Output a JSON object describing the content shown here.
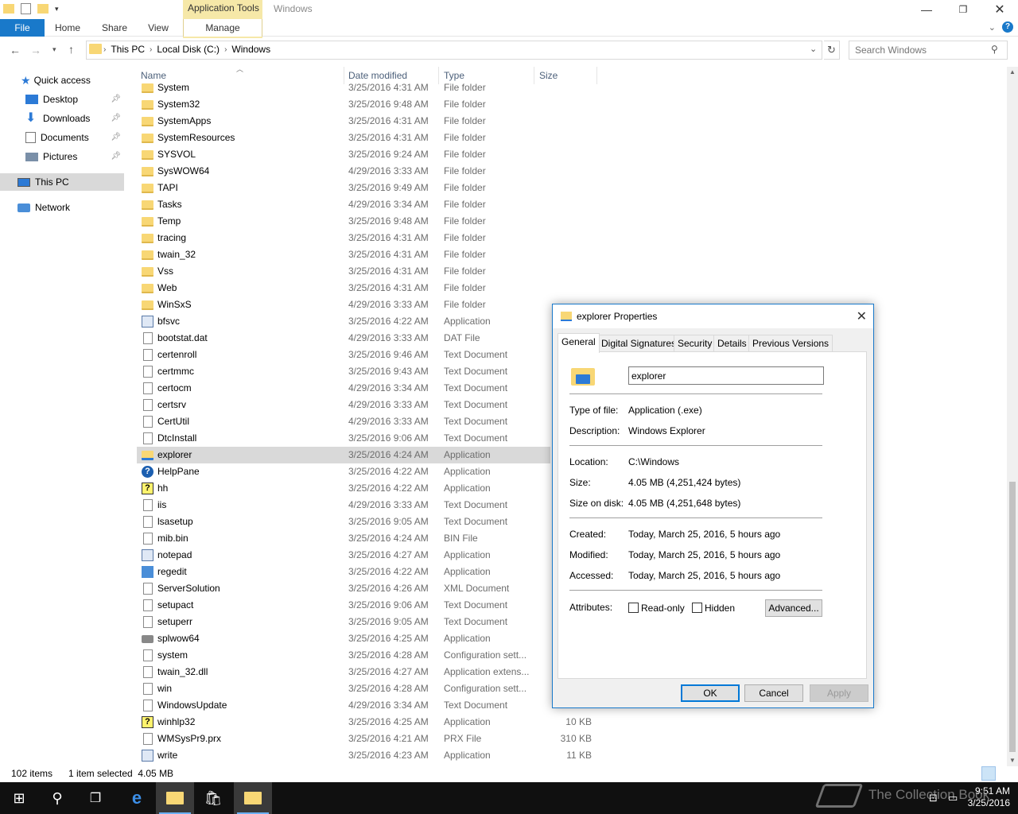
{
  "window": {
    "title": "Windows",
    "app_tools": "Application Tools"
  },
  "ribbon": {
    "tabs": [
      "File",
      "Home",
      "Share",
      "View",
      "Manage"
    ]
  },
  "address": {
    "crumbs": [
      "This PC",
      "Local Disk (C:)",
      "Windows"
    ],
    "search_placeholder": "Search Windows"
  },
  "nav": {
    "quick_access": "Quick access",
    "items": [
      "Desktop",
      "Downloads",
      "Documents",
      "Pictures"
    ],
    "this_pc": "This PC",
    "network": "Network"
  },
  "columns": {
    "name": "Name",
    "date": "Date modified",
    "type": "Type",
    "size": "Size"
  },
  "files": [
    {
      "name": "System",
      "date": "3/25/2016 4:31 AM",
      "type": "File folder",
      "size": "",
      "icon": "folder"
    },
    {
      "name": "System32",
      "date": "3/25/2016 9:48 AM",
      "type": "File folder",
      "size": "",
      "icon": "folder"
    },
    {
      "name": "SystemApps",
      "date": "3/25/2016 4:31 AM",
      "type": "File folder",
      "size": "",
      "icon": "folder"
    },
    {
      "name": "SystemResources",
      "date": "3/25/2016 4:31 AM",
      "type": "File folder",
      "size": "",
      "icon": "folder"
    },
    {
      "name": "SYSVOL",
      "date": "3/25/2016 9:24 AM",
      "type": "File folder",
      "size": "",
      "icon": "folder"
    },
    {
      "name": "SysWOW64",
      "date": "4/29/2016 3:33 AM",
      "type": "File folder",
      "size": "",
      "icon": "folder"
    },
    {
      "name": "TAPI",
      "date": "3/25/2016 9:49 AM",
      "type": "File folder",
      "size": "",
      "icon": "folder"
    },
    {
      "name": "Tasks",
      "date": "4/29/2016 3:34 AM",
      "type": "File folder",
      "size": "",
      "icon": "folder"
    },
    {
      "name": "Temp",
      "date": "3/25/2016 9:48 AM",
      "type": "File folder",
      "size": "",
      "icon": "folder"
    },
    {
      "name": "tracing",
      "date": "3/25/2016 4:31 AM",
      "type": "File folder",
      "size": "",
      "icon": "folder"
    },
    {
      "name": "twain_32",
      "date": "3/25/2016 4:31 AM",
      "type": "File folder",
      "size": "",
      "icon": "folder"
    },
    {
      "name": "Vss",
      "date": "3/25/2016 4:31 AM",
      "type": "File folder",
      "size": "",
      "icon": "folder"
    },
    {
      "name": "Web",
      "date": "3/25/2016 4:31 AM",
      "type": "File folder",
      "size": "",
      "icon": "folder"
    },
    {
      "name": "WinSxS",
      "date": "4/29/2016 3:33 AM",
      "type": "File folder",
      "size": "",
      "icon": "folder"
    },
    {
      "name": "bfsvc",
      "date": "3/25/2016 4:22 AM",
      "type": "Application",
      "size": "",
      "icon": "app"
    },
    {
      "name": "bootstat.dat",
      "date": "4/29/2016 3:33 AM",
      "type": "DAT File",
      "size": "",
      "icon": "doc"
    },
    {
      "name": "certenroll",
      "date": "3/25/2016 9:46 AM",
      "type": "Text Document",
      "size": "",
      "icon": "doc"
    },
    {
      "name": "certmmc",
      "date": "3/25/2016 9:43 AM",
      "type": "Text Document",
      "size": "",
      "icon": "doc"
    },
    {
      "name": "certocm",
      "date": "4/29/2016 3:34 AM",
      "type": "Text Document",
      "size": "",
      "icon": "doc"
    },
    {
      "name": "certsrv",
      "date": "4/29/2016 3:33 AM",
      "type": "Text Document",
      "size": "",
      "icon": "doc"
    },
    {
      "name": "CertUtil",
      "date": "4/29/2016 3:33 AM",
      "type": "Text Document",
      "size": "",
      "icon": "doc"
    },
    {
      "name": "DtcInstall",
      "date": "3/25/2016 9:06 AM",
      "type": "Text Document",
      "size": "",
      "icon": "doc"
    },
    {
      "name": "explorer",
      "date": "3/25/2016 4:24 AM",
      "type": "Application",
      "size": "",
      "icon": "explorer",
      "selected": true
    },
    {
      "name": "HelpPane",
      "date": "3/25/2016 4:22 AM",
      "type": "Application",
      "size": "",
      "icon": "help"
    },
    {
      "name": "hh",
      "date": "3/25/2016 4:22 AM",
      "type": "Application",
      "size": "",
      "icon": "hh"
    },
    {
      "name": "iis",
      "date": "4/29/2016 3:33 AM",
      "type": "Text Document",
      "size": "",
      "icon": "doc"
    },
    {
      "name": "lsasetup",
      "date": "3/25/2016 9:05 AM",
      "type": "Text Document",
      "size": "",
      "icon": "doc"
    },
    {
      "name": "mib.bin",
      "date": "3/25/2016 4:24 AM",
      "type": "BIN File",
      "size": "",
      "icon": "doc"
    },
    {
      "name": "notepad",
      "date": "3/25/2016 4:27 AM",
      "type": "Application",
      "size": "",
      "icon": "app"
    },
    {
      "name": "regedit",
      "date": "3/25/2016 4:22 AM",
      "type": "Application",
      "size": "",
      "icon": "reg"
    },
    {
      "name": "ServerSolution",
      "date": "3/25/2016 4:26 AM",
      "type": "XML Document",
      "size": "",
      "icon": "doc"
    },
    {
      "name": "setupact",
      "date": "3/25/2016 9:06 AM",
      "type": "Text Document",
      "size": "",
      "icon": "doc"
    },
    {
      "name": "setuperr",
      "date": "3/25/2016 9:05 AM",
      "type": "Text Document",
      "size": "",
      "icon": "doc"
    },
    {
      "name": "splwow64",
      "date": "3/25/2016 4:25 AM",
      "type": "Application",
      "size": "",
      "icon": "print"
    },
    {
      "name": "system",
      "date": "3/25/2016 4:28 AM",
      "type": "Configuration sett...",
      "size": "",
      "icon": "doc"
    },
    {
      "name": "twain_32.dll",
      "date": "3/25/2016 4:27 AM",
      "type": "Application extens...",
      "size": "",
      "icon": "doc"
    },
    {
      "name": "win",
      "date": "3/25/2016 4:28 AM",
      "type": "Configuration sett...",
      "size": "",
      "icon": "doc"
    },
    {
      "name": "WindowsUpdate",
      "date": "4/29/2016 3:34 AM",
      "type": "Text Document",
      "size": "",
      "icon": "doc"
    },
    {
      "name": "winhlp32",
      "date": "3/25/2016 4:25 AM",
      "type": "Application",
      "size": "10 KB",
      "icon": "hh"
    },
    {
      "name": "WMSysPr9.prx",
      "date": "3/25/2016 4:21 AM",
      "type": "PRX File",
      "size": "310 KB",
      "icon": "doc"
    },
    {
      "name": "write",
      "date": "3/25/2016 4:23 AM",
      "type": "Application",
      "size": "11 KB",
      "icon": "app"
    }
  ],
  "status": {
    "count": "102 items",
    "selection": "1 item selected  4.05 MB"
  },
  "taskbar": {
    "time": "9:51 AM",
    "date": "3/25/2016",
    "watermark": "The Collection Book"
  },
  "dialog": {
    "title": "explorer Properties",
    "tabs": [
      "General",
      "Digital Signatures",
      "Security",
      "Details",
      "Previous Versions"
    ],
    "file_name": "explorer",
    "type_label": "Type of file:",
    "type_value": "Application (.exe)",
    "desc_label": "Description:",
    "desc_value": "Windows Explorer",
    "location_label": "Location:",
    "location_value": "C:\\Windows",
    "size_label": "Size:",
    "size_value": "4.05 MB (4,251,424 bytes)",
    "sod_label": "Size on disk:",
    "sod_value": "4.05 MB (4,251,648 bytes)",
    "created_label": "Created:",
    "created_value": "Today, March 25, 2016, 5 hours ago",
    "modified_label": "Modified:",
    "modified_value": "Today, March 25, 2016, 5 hours ago",
    "accessed_label": "Accessed:",
    "accessed_value": "Today, March 25, 2016, 5 hours ago",
    "attributes_label": "Attributes:",
    "readonly_label": "Read-only",
    "hidden_label": "Hidden",
    "advanced_label": "Advanced...",
    "ok_label": "OK",
    "cancel_label": "Cancel",
    "apply_label": "Apply"
  }
}
